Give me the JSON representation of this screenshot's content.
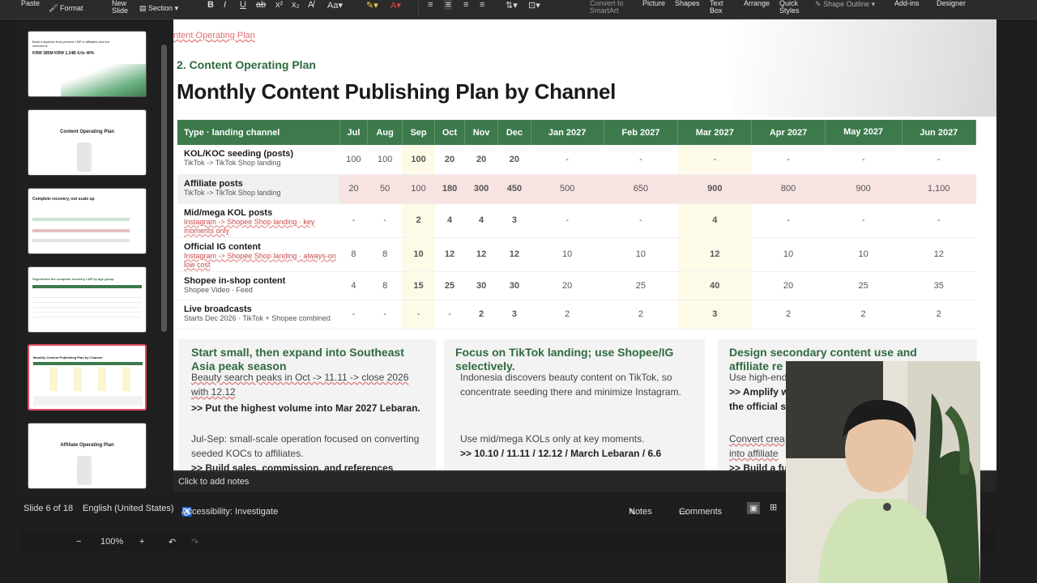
{
  "ribbon": {
    "paste": "Paste",
    "format": "Format",
    "new_slide": "New\nSlide",
    "section": "Section",
    "bold": "B",
    "italic": "I",
    "convert": "Convert to\nSmartArt",
    "picture": "Picture",
    "shapes": "Shapes",
    "textbox": "Text\nBox",
    "arrange": "Arrange",
    "quick_styles": "Quick\nStyles",
    "shape_outline": "Shape Outline",
    "addins": "Add-ins",
    "designer": "Designer"
  },
  "slide": {
    "crumb": "ntent Operating Plan",
    "section_title": "2. Content Operating Plan",
    "title": "Monthly Content Publishing Plan by Channel",
    "table": {
      "header": [
        "Type · landing channel",
        "Jul",
        "Aug",
        "Sep",
        "Oct",
        "Nov",
        "Dec",
        "Jan 2027",
        "Feb 2027",
        "Mar 2027",
        "Apr 2027",
        "May 2027",
        "Jun 2027"
      ],
      "rows": [
        {
          "name": "KOL/KOC seeding (posts)",
          "sub": "TikTok -> TikTok Shop landing",
          "values": [
            "100",
            "100",
            "100",
            "20",
            "20",
            "20",
            "-",
            "-",
            "-",
            "-",
            "-",
            "-"
          ]
        },
        {
          "name": "Affiliate posts",
          "sub": "TikTok -> TikTok Shop landing",
          "values": [
            "20",
            "50",
            "100",
            "180",
            "300",
            "450",
            "500",
            "650",
            "900",
            "800",
            "900",
            "1,100"
          ]
        },
        {
          "name": "Mid/mega KOL posts",
          "sub": "Instagram -> Shopee Shop landing · key moments only",
          "values": [
            "-",
            "-",
            "2",
            "4",
            "4",
            "3",
            "-",
            "-",
            "4",
            "-",
            "-",
            "-"
          ]
        },
        {
          "name": "Official IG content",
          "sub": "Instagram -> Shopee Shop landing · always-on low cost",
          "values": [
            "8",
            "8",
            "10",
            "12",
            "12",
            "12",
            "10",
            "10",
            "12",
            "10",
            "10",
            "12"
          ]
        },
        {
          "name": "Shopee in-shop content",
          "sub": "Shopee Video · Feed",
          "values": [
            "4",
            "8",
            "15",
            "25",
            "30",
            "30",
            "20",
            "25",
            "40",
            "20",
            "25",
            "35"
          ]
        },
        {
          "name": "Live broadcasts",
          "sub": "Starts Dec 2026 · TikTok + Shopee combined",
          "values": [
            "-",
            "-",
            "-",
            "-",
            "2",
            "3",
            "2",
            "2",
            "3",
            "2",
            "2",
            "2"
          ]
        }
      ]
    },
    "columns": [
      {
        "title": "Start small, then expand into Southeast Asia peak season",
        "p1": "Beauty search peaks in Oct -> 11.11 -> close 2026 with 12.12",
        "p2": ">> Put the highest volume into Mar 2027 Lebaran.",
        "p3": "Jul-Sep: small-scale operation focused on converting seeded KOCs to affiliates.",
        "p4": ">> Build sales, commission, and references"
      },
      {
        "title": "Focus on TikTok landing; use Shopee/IG selectively.",
        "p1": "Indonesia discovers beauty content on TikTok, so concentrate seeding there and minimize Instagram.",
        "p2": "Use mid/mega KOLs only at key moments.",
        "p3": ">> 10.10 / 11.11 / 12.12 / March Lebaran / 6.6"
      },
      {
        "title": "Design secondary content use and affiliate re",
        "p1": "Use high-end",
        "p2": ">> Amplify w",
        "p3": "the official s",
        "p4": "Convert crea",
        "p5": "into affiliate",
        "p6": ">> Build a fu"
      }
    ]
  },
  "notes": {
    "placeholder": "Click to add notes"
  },
  "status": {
    "slide_of": "Slide 6 of 18",
    "language": "English (United States)",
    "accessibility": "Accessibility: Investigate",
    "notes": "Notes",
    "comments": "Comments",
    "zoom": "100%"
  },
  "thumbs": {
    "t1_title": "Build a flywheel from present LNP to affiliates and live commerce",
    "t1_stats": "KRW 385M   KRW 1.24B   4.0x   40%",
    "t2_title": "Content Operating Plan",
    "t3_title": "Complete recovery, not scale up",
    "t4_title": "Segmented the complete recovery LNP by age group",
    "t5_title": "Monthly Content Publishing Plan by Channel",
    "t6_title": "Affiliate Operating Plan"
  },
  "colors": {
    "accent_green": "#3c7a4c",
    "title_green": "#2e6a3f",
    "active_border": "#e04a5b"
  }
}
